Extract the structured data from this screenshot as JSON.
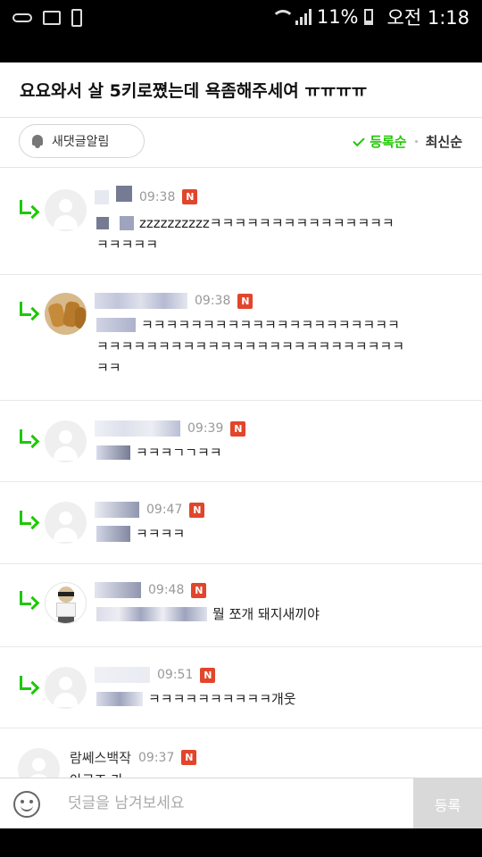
{
  "status_bar": {
    "battery": "11%",
    "time": "오전 1:18",
    "icons": [
      "glasses-icon",
      "gallery-icon",
      "phone-icon",
      "wifi-icon",
      "signal-icon",
      "battery-icon"
    ]
  },
  "header": {
    "title": "요요와서 살 5키로쪘는데 욕좀해주세여 ㅠㅠㅠㅠ"
  },
  "sort_bar": {
    "notify_label": "새댓글알림",
    "sort_active": "등록순",
    "sort_other": "최신순",
    "accent": "#1ec800"
  },
  "comments": [
    {
      "time": "09:38",
      "badge": "N",
      "text_line1": "zzzzzzzzzzㅋㅋㅋㅋㅋㅋㅋㅋㅋㅋㅋㅋㅋㅋㅋ",
      "text_line2": "ㅋㅋㅋㅋㅋ"
    },
    {
      "time": "09:38",
      "badge": "N",
      "text_line1": "ㅋㅋㅋㅋㅋㅋㅋㅋㅋㅋㅋㅋㅋㅋㅋㅋㅋㅋㅋㅋㅋ",
      "text_line2": "ㅋㅋㅋㅋㅋㅋㅋㅋㅋㅋㅋㅋㅋㅋㅋㅋㅋㅋㅋㅋㅋㅋㅋㅋㅋ",
      "text_line3": "ㅋㅋ"
    },
    {
      "time": "09:39",
      "badge": "N",
      "text": "ㅋㅋㅋㄱㄱㅋㅋ"
    },
    {
      "time": "09:47",
      "badge": "N",
      "text": "ㅋㅋㅋㅋ"
    },
    {
      "time": "09:48",
      "badge": "N",
      "text": "뭘 쪼개 돼지새끼야"
    },
    {
      "time": "09:51",
      "badge": "N",
      "text": "ㅋㅋㅋㅋㅋㅋㅋㅋㅋㅋ개웃"
    },
    {
      "name": "람쎄스백작",
      "time": "09:37",
      "badge": "N",
      "text": "아근즈 가"
    }
  ],
  "input_bar": {
    "placeholder": "덧글을 남겨보세요",
    "submit_label": "등록"
  },
  "colors": {
    "new_badge": "#e1452b",
    "reply_arrow": "#1ec800"
  }
}
